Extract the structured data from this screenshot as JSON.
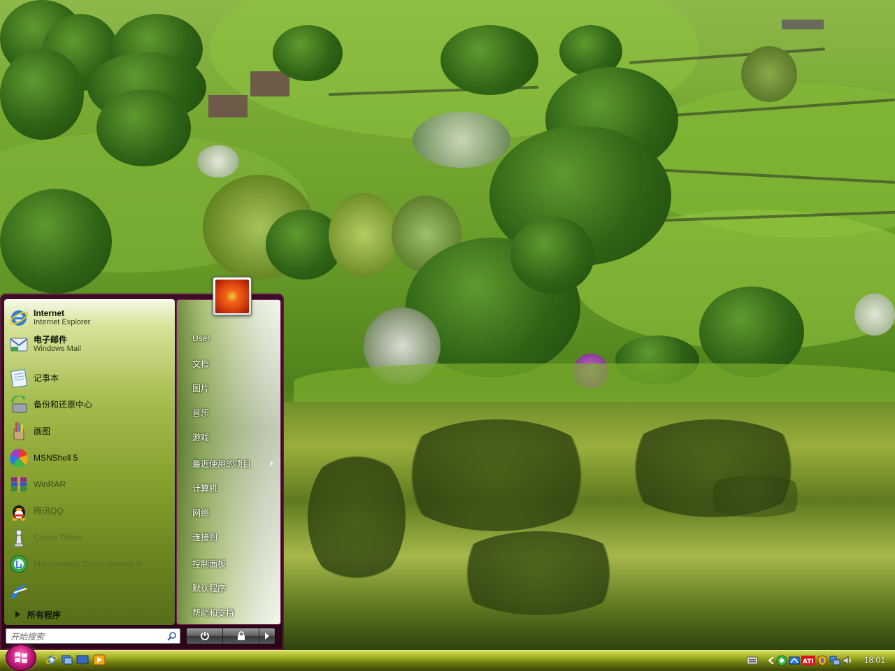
{
  "start_menu": {
    "programs": [
      {
        "name": "Internet",
        "subtitle": "Internet Explorer",
        "icon": "ie-icon"
      },
      {
        "name": "电子邮件",
        "subtitle": "Windows Mail",
        "icon": "mail-icon"
      },
      {
        "name": "记事本",
        "icon": "notepad-icon"
      },
      {
        "name": "备份和还原中心",
        "icon": "backup-icon"
      },
      {
        "name": "画图",
        "icon": "paint-icon"
      },
      {
        "name": "MSNShell 5",
        "icon": "msnshell-icon"
      },
      {
        "name": "WinRAR",
        "icon": "winrar-icon"
      },
      {
        "name": "腾讯QQ",
        "icon": "qq-icon"
      },
      {
        "name": "Chess Titans",
        "icon": "chess-icon"
      },
      {
        "name": "Macromedia Dreamweaver 8",
        "icon": "dreamweaver-icon"
      },
      {
        "name": "",
        "icon": "arrow-swoosh-icon"
      }
    ],
    "all_programs_label": "所有程序",
    "right_items": [
      "User",
      "文档",
      "图片",
      "音乐",
      "游戏",
      "最近使用的项目",
      "计算机",
      "网络",
      "连接到",
      "控制面板",
      "默认程序",
      "帮助和支持"
    ],
    "search_placeholder": "开始搜索"
  },
  "taskbar": {
    "clock": "18:01"
  },
  "colors": {
    "menu_frame": "#3d0c26",
    "taskbar_top": "#d2dc5a",
    "orb": "#d6248a"
  }
}
